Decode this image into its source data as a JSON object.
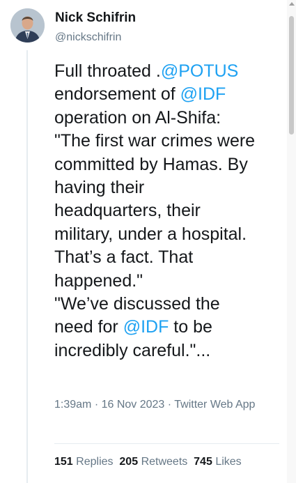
{
  "author": {
    "name": "Nick Schifrin",
    "handle": "@nickschifrin"
  },
  "tweet": {
    "lines": [
      [
        {
          "t": "Full throated ."
        },
        {
          "t": "@POTUS",
          "mention": true
        }
      ],
      [
        {
          "t": "endorsement of "
        },
        {
          "t": "@IDF",
          "mention": true
        }
      ],
      [
        {
          "t": "operation on Al-Shifa:"
        }
      ],
      [
        {
          "t": "\"The first war crimes were"
        }
      ],
      [
        {
          "t": "committed by Hamas. By"
        }
      ],
      [
        {
          "t": "having their"
        }
      ],
      [
        {
          "t": "headquarters, their"
        }
      ],
      [
        {
          "t": "military, under a hospital."
        }
      ],
      [
        {
          "t": "That’s a fact. That"
        }
      ],
      [
        {
          "t": "happened.\""
        }
      ],
      [
        {
          "t": "\"We’ve discussed the"
        }
      ],
      [
        {
          "t": "need for "
        },
        {
          "t": "@IDF",
          "mention": true
        },
        {
          "t": " to be"
        }
      ],
      [
        {
          "t": "incredibly careful.\"..."
        }
      ]
    ],
    "meta": "1:39am · 16 Nov 2023 · Twitter Web App"
  },
  "stats": {
    "replies_count": "151",
    "replies_label": "Replies",
    "retweets_count": "205",
    "retweets_label": "Retweets",
    "likes_count": "745",
    "likes_label": "Likes"
  },
  "colors": {
    "mention": "#1da1f2",
    "secondary_text": "#657786",
    "primary_text": "#14171a"
  }
}
